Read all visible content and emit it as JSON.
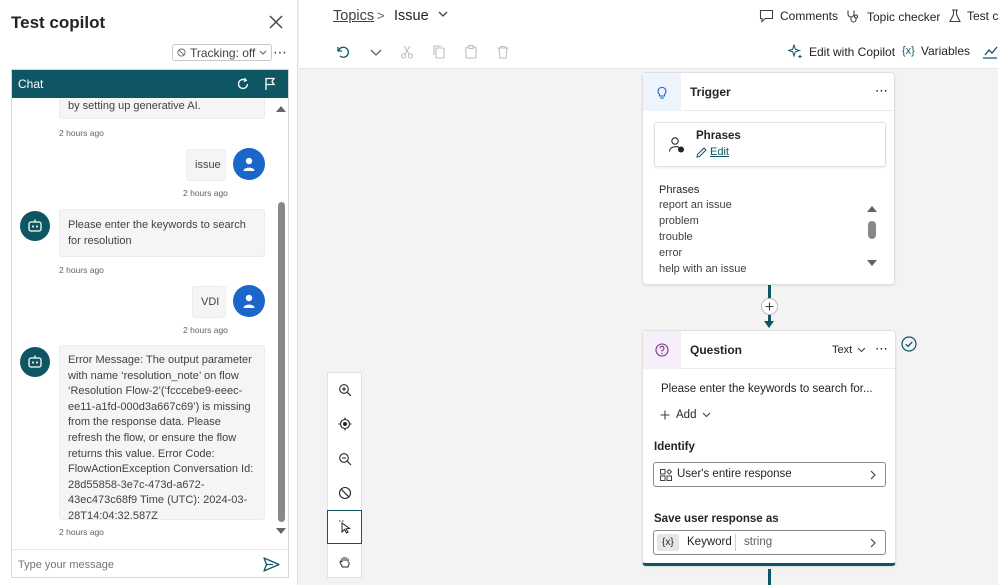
{
  "test_pane": {
    "title": "Test copilot",
    "tracking_label": "Tracking: off",
    "more_label": "⋯",
    "chat": {
      "header": "Chat",
      "messages": [
        {
          "from": "bot",
          "text": "by setting up generative AI.",
          "time": "2 hours ago"
        },
        {
          "from": "user",
          "text": "issue",
          "time": "2 hours ago"
        },
        {
          "from": "bot",
          "text": "Please enter the keywords to search for resolution",
          "time": "2 hours ago"
        },
        {
          "from": "user",
          "text": "VDI",
          "time": "2 hours ago"
        },
        {
          "from": "bot",
          "text": "Error Message: The output parameter with name ‘resolution_note’ on flow ‘Resolution Flow-2’(‘fcccebe9-eeec-ee11-a1fd-000d3a667c69’) is missing from the response data. Please refresh the flow, or ensure the flow returns this value. Error Code: FlowActionException Conversation Id: 28d55858-3e7c-473d-a672-43ec473c68f9 Time (UTC): 2024-03-28T14:04:32.587Z",
          "time": "2 hours ago"
        }
      ],
      "input_placeholder": "Type your message"
    }
  },
  "header": {
    "breadcrumb_root": "Topics",
    "breadcrumb_sep": ">",
    "breadcrumb_current": "Issue",
    "comments": "Comments",
    "topic_checker": "Topic checker",
    "test": "Test co"
  },
  "toolbar": {
    "edit_with_copilot": "Edit with Copilot",
    "variables": "Variables"
  },
  "trigger_node": {
    "title": "Trigger",
    "more": "⋯",
    "card_title": "Phrases",
    "edit_link": "Edit",
    "list_title": "Phrases",
    "phrases": [
      "report an issue",
      "problem",
      "trouble",
      "error",
      "help with an issue"
    ]
  },
  "question_node": {
    "title": "Question",
    "type_label": "Text",
    "more": "⋯",
    "prompt": "Please enter the keywords to search for...",
    "add_label": "Add",
    "identify_label": "Identify",
    "identify_value": "User's entire response",
    "save_label": "Save user response as",
    "var_prefix": "{x}",
    "var_name": "Keyword",
    "var_type": "string"
  },
  "colors": {
    "accent": "#0f5664",
    "user_avatar": "#1a66c9"
  }
}
